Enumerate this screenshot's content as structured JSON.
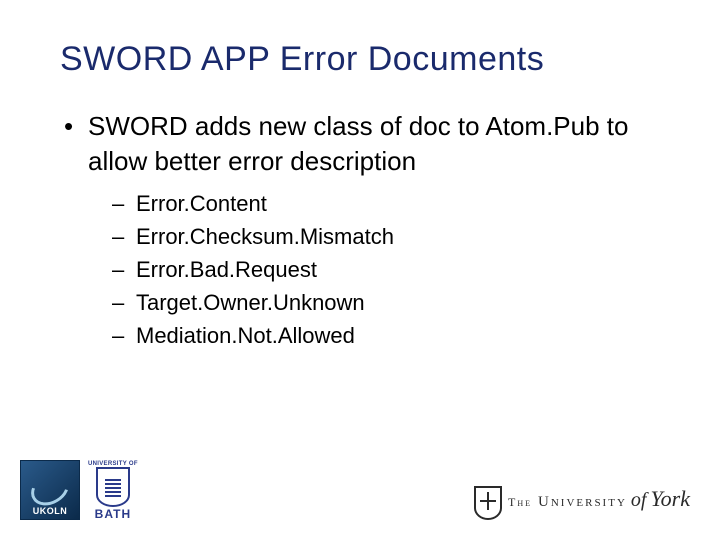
{
  "title": "SWORD APP Error Documents",
  "bullets": [
    {
      "text": "SWORD adds new class of doc to Atom.Pub to allow better error description",
      "sub": [
        "Error.Content",
        "Error.Checksum.Mismatch",
        "Error.Bad.Request",
        "Target.Owner.Unknown",
        "Mediation.Not.Allowed"
      ]
    }
  ],
  "logos": {
    "ukoln": "UKOLN",
    "bath_top": "UNIVERSITY OF",
    "bath_bottom": "BATH",
    "york_the": "The",
    "york_univ": "University",
    "york_of": "of",
    "york_york": "York"
  }
}
